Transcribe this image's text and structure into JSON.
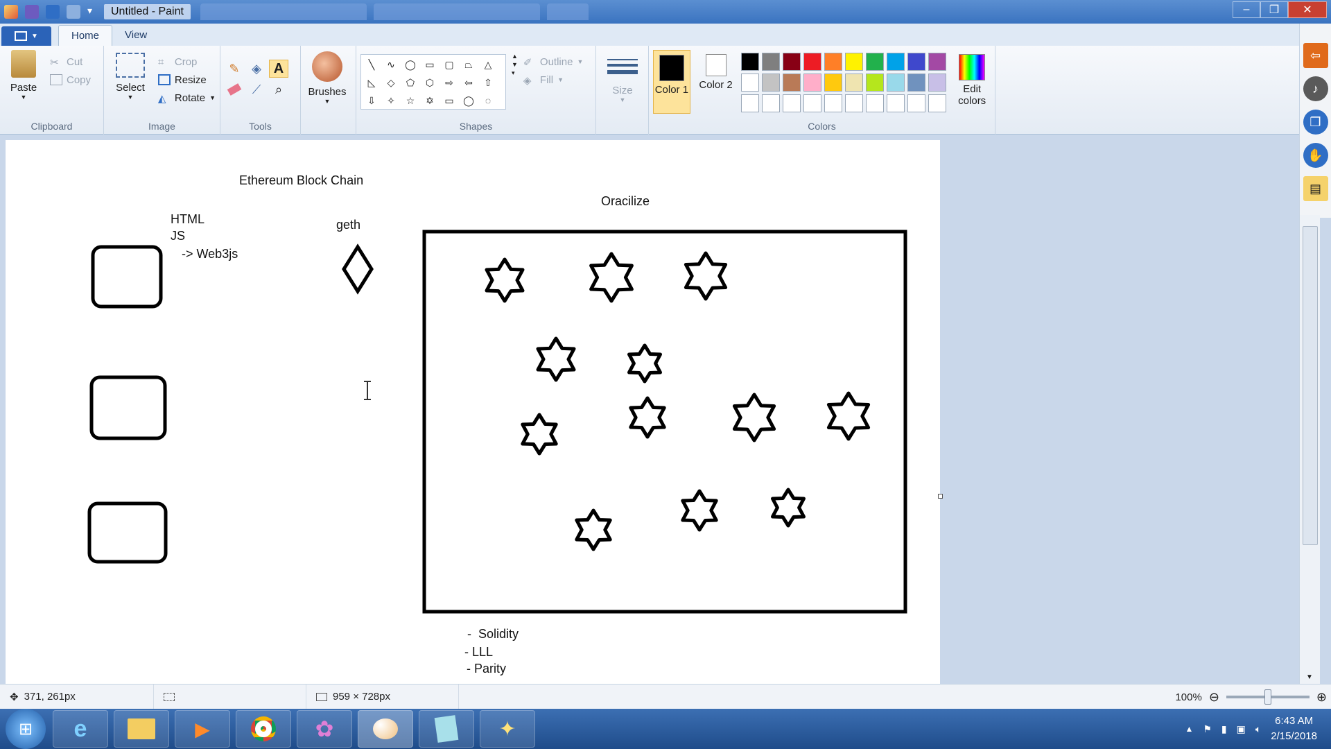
{
  "window": {
    "title": "Untitled - Paint",
    "controls": {
      "minimize": "–",
      "maximize": "❐",
      "close": "✕"
    }
  },
  "ribbon_tabs": [
    {
      "label": "Home",
      "active": true
    },
    {
      "label": "View",
      "active": false
    }
  ],
  "clipboard": {
    "paste": "Paste",
    "cut": "Cut",
    "copy": "Copy",
    "group": "Clipboard"
  },
  "image": {
    "select": "Select",
    "crop": "Crop",
    "resize": "Resize",
    "rotate": "Rotate",
    "group": "Image"
  },
  "tools": {
    "group": "Tools"
  },
  "brushes": {
    "label": "Brushes"
  },
  "shapes": {
    "outline": "Outline",
    "fill": "Fill",
    "group": "Shapes"
  },
  "size": {
    "label": "Size"
  },
  "colors": {
    "color1_label": "Color 1",
    "color2_label": "Color 2",
    "edit_colors": "Edit colors",
    "group": "Colors",
    "color1": "#000000",
    "color2": "#ffffff",
    "palette_row1": [
      "#000000",
      "#7f7f7f",
      "#880015",
      "#ed1c24",
      "#ff7f27",
      "#fff200",
      "#22b14c",
      "#00a2e8",
      "#3f48cc",
      "#a349a4"
    ],
    "palette_row2": [
      "#ffffff",
      "#c3c3c3",
      "#b97a57",
      "#ffaec9",
      "#ffc90e",
      "#efe4b0",
      "#b5e61d",
      "#99d9ea",
      "#7092be",
      "#c8bfe7"
    ],
    "palette_row3": [
      "#ffffff",
      "#ffffff",
      "#ffffff",
      "#ffffff",
      "#ffffff",
      "#ffffff",
      "#ffffff",
      "#ffffff",
      "#ffffff",
      "#ffffff"
    ]
  },
  "canvas": {
    "title": "Ethereum Block Chain",
    "oracle_label": "Oracilize",
    "client_lines": [
      "HTML",
      "JS",
      "-> Web3js"
    ],
    "node_label": "geth",
    "languages": [
      "-  Solidity",
      "- LLL",
      "- Parity"
    ]
  },
  "status": {
    "cursor_pos": "371, 261px",
    "selection_size": "",
    "canvas_size": "959 × 728px",
    "zoom": "100%"
  },
  "clock": {
    "time": "6:43 AM",
    "date": "2/15/2018"
  }
}
